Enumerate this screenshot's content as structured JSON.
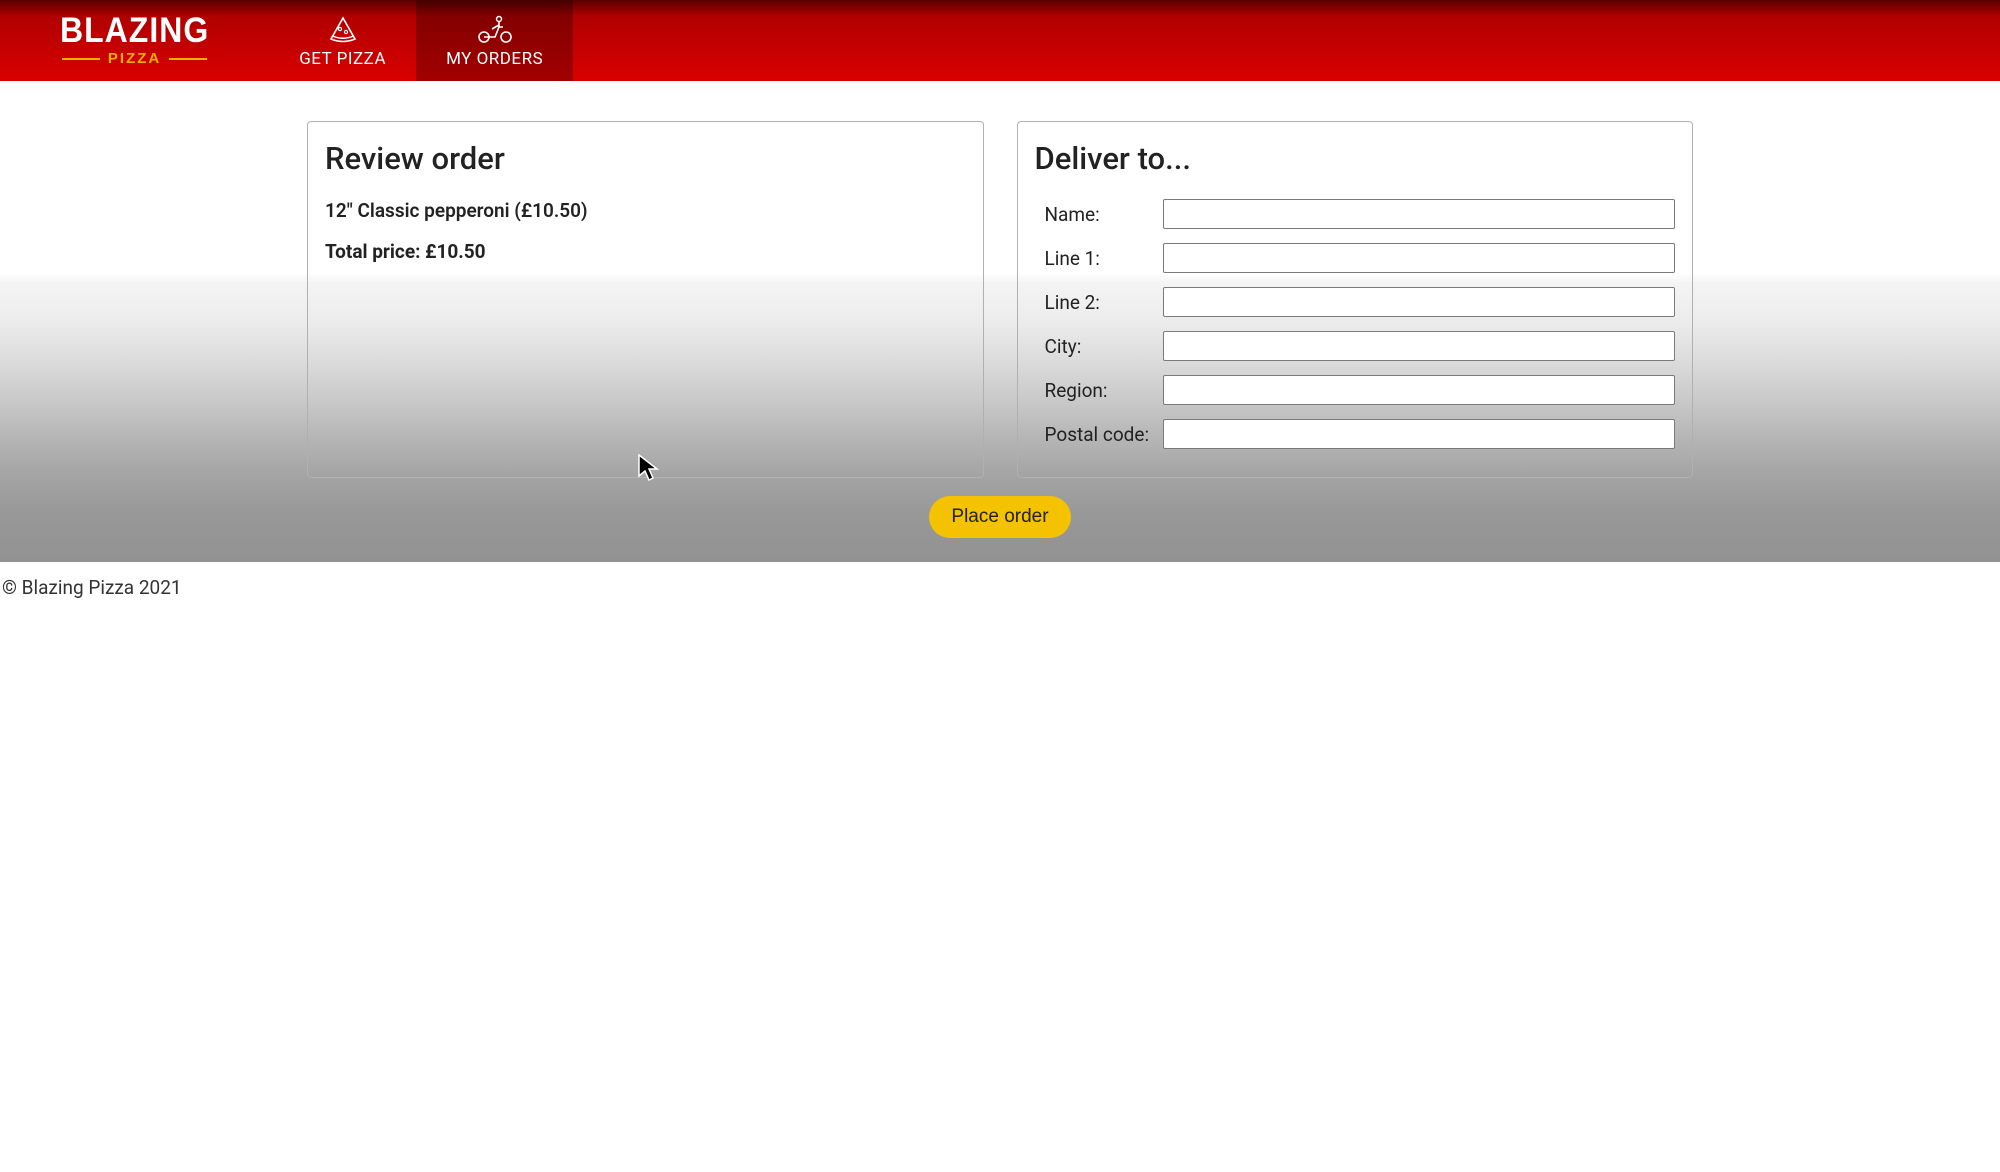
{
  "header": {
    "logo_top": "BLAZING",
    "logo_bottom": "PIZZA",
    "nav": [
      {
        "label": "GET PIZZA"
      },
      {
        "label": "MY ORDERS"
      }
    ]
  },
  "review": {
    "title": "Review order",
    "items": [
      {
        "text": "12\" Classic pepperoni (£10.50)"
      }
    ],
    "total_label": "Total price:",
    "total_value": "£10.50"
  },
  "deliver": {
    "title": "Deliver to...",
    "fields": [
      {
        "label": "Name:",
        "value": ""
      },
      {
        "label": "Line 1:",
        "value": ""
      },
      {
        "label": "Line 2:",
        "value": ""
      },
      {
        "label": "City:",
        "value": ""
      },
      {
        "label": "Region:",
        "value": ""
      },
      {
        "label": "Postal code:",
        "value": ""
      }
    ]
  },
  "actions": {
    "place_order_label": "Place order"
  },
  "footer": {
    "copyright": "© Blazing Pizza 2021"
  }
}
